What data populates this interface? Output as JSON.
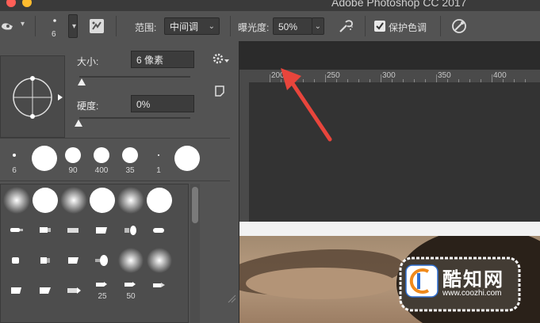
{
  "window": {
    "app_title": "Adobe Photoshop CC 2017",
    "traffic_light_colors": [
      "#ff5f57",
      "#febc2e",
      "#28c840"
    ]
  },
  "options_bar": {
    "brush_size_value": "6",
    "range_label": "范围:",
    "range_value": "中间调",
    "exposure_label": "曝光度:",
    "exposure_value": "50%",
    "protect_tones_label": "保护色调",
    "protect_tones_checked": true,
    "icons": [
      "dodge-tool-icon",
      "chevron-down-icon",
      "brush-preset-icon",
      "brush-panel-toggle-icon",
      "airbrush-icon",
      "pressure-size-icon"
    ]
  },
  "brush_panel": {
    "size_label": "大小:",
    "size_value": "6 像素",
    "size_slider_fraction": 0.02,
    "hardness_label": "硬度:",
    "hardness_value": "0%",
    "hardness_slider_fraction": 0.0,
    "recent_brush_sizes": [
      "6",
      "90",
      "400",
      "35",
      "1"
    ],
    "grid_labels": [
      "25",
      "50"
    ],
    "icons": [
      "settings-gear-icon",
      "new-preset-icon",
      "resize-grip-icon"
    ]
  },
  "ruler": {
    "labels": [
      "200",
      "250",
      "300",
      "350",
      "400"
    ]
  },
  "annotation": {
    "arrow_color": "#e8453c"
  },
  "watermark": {
    "brand": "酷知网",
    "url": "www.coozhi.com"
  }
}
